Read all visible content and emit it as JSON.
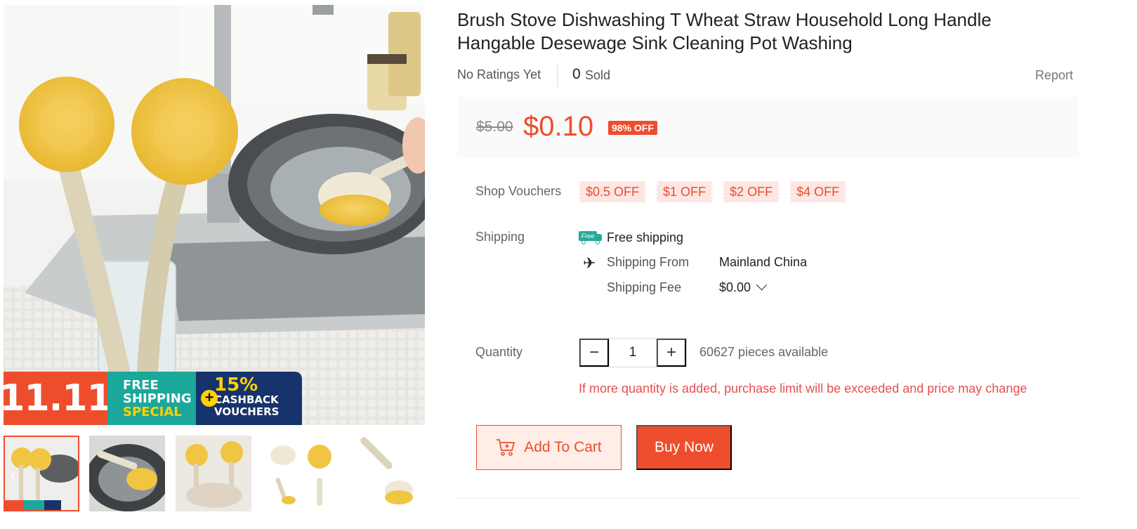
{
  "gallery": {
    "promo": {
      "date": "11.11",
      "free_line1": "FREE",
      "free_line2": "SHIPPING",
      "free_line3": "SPECIAL",
      "plus": "+",
      "cash_pct": "15%",
      "cash_line1": "CASHBACK",
      "cash_line2": "VOUCHERS"
    },
    "thumbnails_count": 5,
    "prev_arrow": "‹",
    "icons": {
      "prev": "chevron-left-icon"
    }
  },
  "product": {
    "title": "Brush Stove Dishwashing T Wheat Straw Household Long Handle Hangable Desewage Sink Cleaning Pot Washing",
    "ratings": "No Ratings Yet",
    "sold_count": "0",
    "sold_label": "Sold",
    "report": "Report"
  },
  "price": {
    "original": "$5.00",
    "current": "$0.10",
    "discount": "98% OFF",
    "accent_color": "#ee4d2d"
  },
  "vouchers": {
    "label": "Shop Vouchers",
    "items": [
      "$0.5 OFF",
      "$1 OFF",
      "$2 OFF",
      "$4 OFF"
    ]
  },
  "shipping": {
    "label": "Shipping",
    "free_badge": "Free",
    "free_text": "Free shipping",
    "from_label": "Shipping From",
    "from_value": "Mainland China",
    "fee_label": "Shipping Fee",
    "fee_value": "$0.00",
    "icons": {
      "free": "truck-icon",
      "from": "airplane-icon",
      "fee": "chevron-down-icon"
    }
  },
  "quantity": {
    "label": "Quantity",
    "minus": "−",
    "value": "1",
    "plus": "+",
    "available": "60627 pieces available",
    "warning": "If more quantity is added, purchase limit will be exceeded and price may change"
  },
  "actions": {
    "add_to_cart": "Add To Cart",
    "buy_now": "Buy Now",
    "icons": {
      "cart": "cart-add-icon"
    }
  }
}
